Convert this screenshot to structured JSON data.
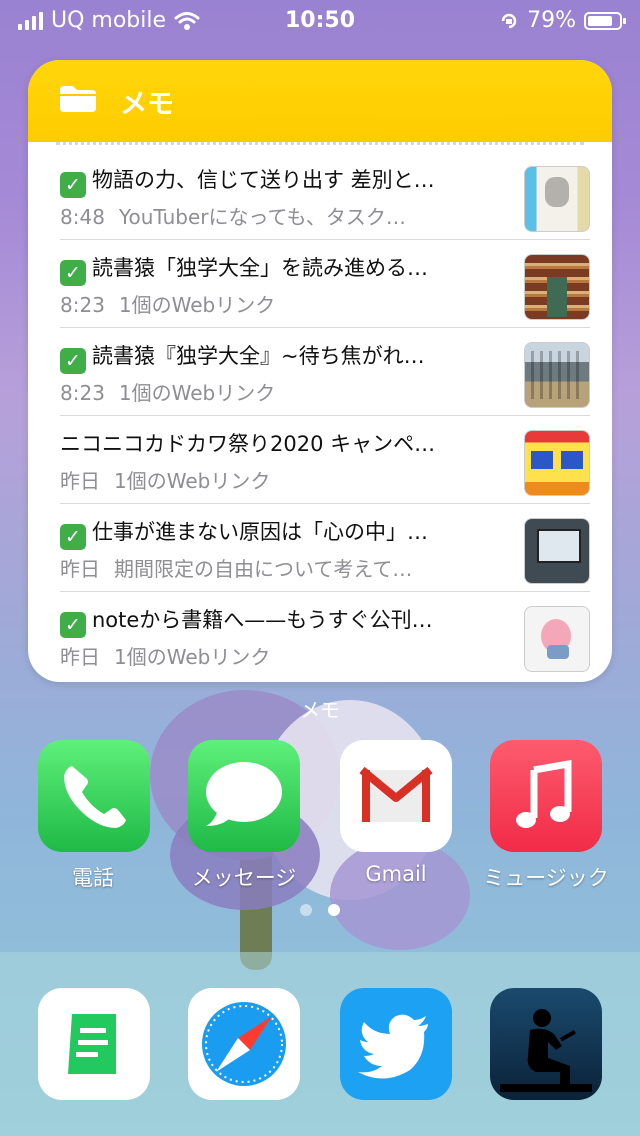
{
  "status_bar": {
    "carrier": "UQ mobile",
    "time": "10:50",
    "battery": "79%",
    "battery_level": 0.79
  },
  "widget": {
    "title": "メモ",
    "label": "メモ",
    "notes": [
      {
        "checked": true,
        "title": "物語の力、信じて送り出す 差別と…",
        "time": "8:48",
        "snippet": "YouTuberになっても、タスク…"
      },
      {
        "checked": true,
        "title": "読書猿「独学大全」を読み進める…",
        "time": "8:23",
        "snippet": "1個のWebリンク"
      },
      {
        "checked": true,
        "title": "読書猿『独学大全』~待ち焦がれ…",
        "time": "8:23",
        "snippet": "1個のWebリンク"
      },
      {
        "checked": false,
        "title": "ニコニコカドカワ祭り2020 キャンペ…",
        "time": "昨日",
        "snippet": "1個のWebリンク"
      },
      {
        "checked": true,
        "title": "仕事が進まない原因は「心の中」…",
        "time": "昨日",
        "snippet": "期間限定の自由について考えて…"
      },
      {
        "checked": true,
        "title": "noteから書籍へ——もうすぐ公刊…",
        "time": "昨日",
        "snippet": "1個のWebリンク"
      }
    ]
  },
  "apps": [
    {
      "label": "電話",
      "icon": "phone-icon",
      "color": "#2fd158"
    },
    {
      "label": "メッセージ",
      "icon": "messages-icon",
      "color": "#2fd158"
    },
    {
      "label": "Gmail",
      "icon": "gmail-icon",
      "color": "#ffffff"
    },
    {
      "label": "ミュージック",
      "icon": "music-icon",
      "color": "#fb3c56"
    }
  ],
  "dock": [
    {
      "icon": "notes-app-icon",
      "color": "#ffffff"
    },
    {
      "icon": "safari-icon",
      "color": "#ffffff"
    },
    {
      "icon": "twitter-icon",
      "color": "#1da1f2"
    },
    {
      "icon": "kindle-icon",
      "color": "#0f2a44"
    }
  ]
}
